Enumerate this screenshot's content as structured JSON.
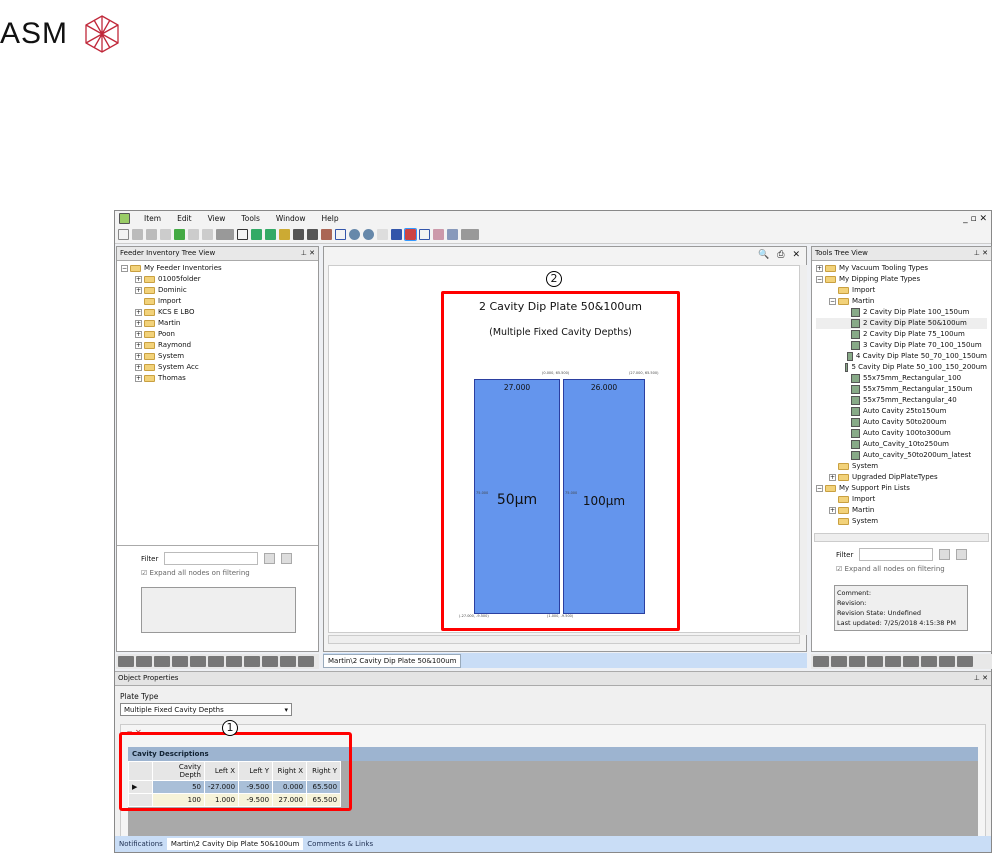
{
  "logo": {
    "text": "ASM"
  },
  "menu": [
    "Item",
    "Edit",
    "View",
    "Tools",
    "Window",
    "Help"
  ],
  "left_panel": {
    "title": "Feeder Inventory Tree View",
    "root": "My Feeder Inventories",
    "items": [
      "01005folder",
      "Dominic",
      "Import",
      "KCS E LBO",
      "Martin",
      "Poon",
      "Raymond",
      "System",
      "System Acc",
      "Thomas"
    ],
    "filter_label": "Filter",
    "expand_label": "Expand all nodes on filtering"
  },
  "center": {
    "tab": "Martin\\2 Cavity Dip Plate 50&100um",
    "title": "2 Cavity Dip Plate 50&100um",
    "subtitle": "(Multiple Fixed Cavity Depths)",
    "callout": "2",
    "cavities": [
      {
        "width_label": "27.000",
        "depth_label": "50µm",
        "height_label": "75.000"
      },
      {
        "width_label": "26.000",
        "depth_label": "100µm",
        "height_label": "75.000"
      }
    ],
    "coords": {
      "top_mid": "(0.000, 65.500)",
      "top_right": "(27.000, 65.500)",
      "bottom_left": "(-27.000, -9.500)",
      "bottom_mid": "(1.000, -9.500)"
    }
  },
  "right_panel": {
    "title": "Tools Tree View",
    "tree": [
      {
        "label": "My Vacuum Tooling Types",
        "level": 0,
        "type": "folder",
        "exp": "+"
      },
      {
        "label": "My Dipping Plate Types",
        "level": 0,
        "type": "folder",
        "exp": "-"
      },
      {
        "label": "Import",
        "level": 1,
        "type": "folder"
      },
      {
        "label": "Martin",
        "level": 1,
        "type": "folder",
        "exp": "-"
      },
      {
        "label": "2 Cavity Dip Plate 100_150um",
        "level": 2,
        "type": "plate"
      },
      {
        "label": "2 Cavity Dip Plate 50&100um",
        "level": 2,
        "type": "plate"
      },
      {
        "label": "2 Cavity Dip Plate 75_100um",
        "level": 2,
        "type": "plate"
      },
      {
        "label": "3 Cavity Dip Plate 70_100_150um",
        "level": 2,
        "type": "plate"
      },
      {
        "label": "4 Cavity Dip Plate 50_70_100_150um",
        "level": 2,
        "type": "plate"
      },
      {
        "label": "5 Cavity Dip Plate 50_100_150_200um",
        "level": 2,
        "type": "plate"
      },
      {
        "label": "55x75mm_Rectangular_100",
        "level": 2,
        "type": "plate"
      },
      {
        "label": "55x75mm_Rectangular_150um",
        "level": 2,
        "type": "plate"
      },
      {
        "label": "55x75mm_Rectangular_40",
        "level": 2,
        "type": "plate"
      },
      {
        "label": "Auto Cavity 25to150um",
        "level": 2,
        "type": "plate"
      },
      {
        "label": "Auto Cavity 50to200um",
        "level": 2,
        "type": "plate"
      },
      {
        "label": "Auto Cavity 100to300um",
        "level": 2,
        "type": "plate"
      },
      {
        "label": "Auto_Cavity_10to250um",
        "level": 2,
        "type": "plate"
      },
      {
        "label": "Auto_cavity_50to200um_latest",
        "level": 2,
        "type": "plate"
      },
      {
        "label": "System",
        "level": 1,
        "type": "folder"
      },
      {
        "label": "Upgraded DipPlateTypes",
        "level": 1,
        "type": "folder",
        "exp": "+"
      },
      {
        "label": "My Support Pin Lists",
        "level": 0,
        "type": "folder",
        "exp": "-"
      },
      {
        "label": "Import",
        "level": 1,
        "type": "folder"
      },
      {
        "label": "Martin",
        "level": 1,
        "type": "folder",
        "exp": "+"
      },
      {
        "label": "System",
        "level": 1,
        "type": "folder"
      }
    ],
    "filter_label": "Filter",
    "expand_label": "Expand all nodes on filtering",
    "info": [
      "Comment:",
      "Revision:",
      "Revision State: Undefined",
      "Last updated: 7/25/2018 4:15:38 PM"
    ]
  },
  "props": {
    "title": "Object Properties",
    "plate_type_label": "Plate Type",
    "plate_type_value": "Multiple Fixed Cavity Depths",
    "callout": "1",
    "grid_title": "Cavity Descriptions",
    "columns": [
      "Cavity Depth",
      "Left X",
      "Left Y",
      "Right X",
      "Right Y"
    ],
    "rows": [
      [
        "50",
        "-27.000",
        "-9.500",
        "0.000",
        "65.500"
      ],
      [
        "100",
        "1.000",
        "-9.500",
        "27.000",
        "65.500"
      ]
    ]
  },
  "bottom_tabs": [
    "Notifications",
    "Martin\\2 Cavity Dip Plate 50&100um",
    "Comments & Links"
  ],
  "colors": {
    "accent": "#ff0000",
    "cavity": "#6495ed",
    "selected_row": "#a9bfd8",
    "alt_row": "#f6f3d9"
  }
}
